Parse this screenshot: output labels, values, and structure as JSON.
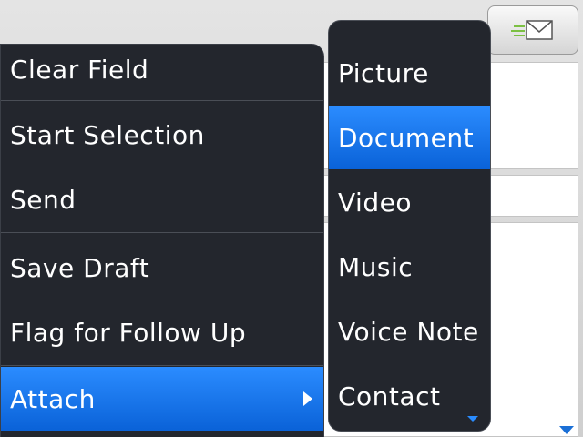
{
  "main_menu": {
    "items": [
      {
        "label": "Clear Field"
      },
      {
        "label": "Start Selection"
      },
      {
        "label": "Send"
      },
      {
        "label": "Save Draft"
      },
      {
        "label": "Flag for Follow Up"
      },
      {
        "label": "Attach"
      }
    ],
    "selected_label": "Attach"
  },
  "attach_submenu": {
    "items": [
      {
        "label": "Picture"
      },
      {
        "label": "Document"
      },
      {
        "label": "Video"
      },
      {
        "label": "Music"
      },
      {
        "label": "Voice Note"
      },
      {
        "label": "Contact"
      }
    ],
    "selected_label": "Document"
  },
  "icons": {
    "send": "envelope-send-icon",
    "submenu": "chevron-right-icon",
    "scroll": "triangle-down-icon"
  },
  "colors": {
    "menu_bg": "#23262d",
    "highlight": "#1a74ee",
    "text": "#ffffff"
  }
}
